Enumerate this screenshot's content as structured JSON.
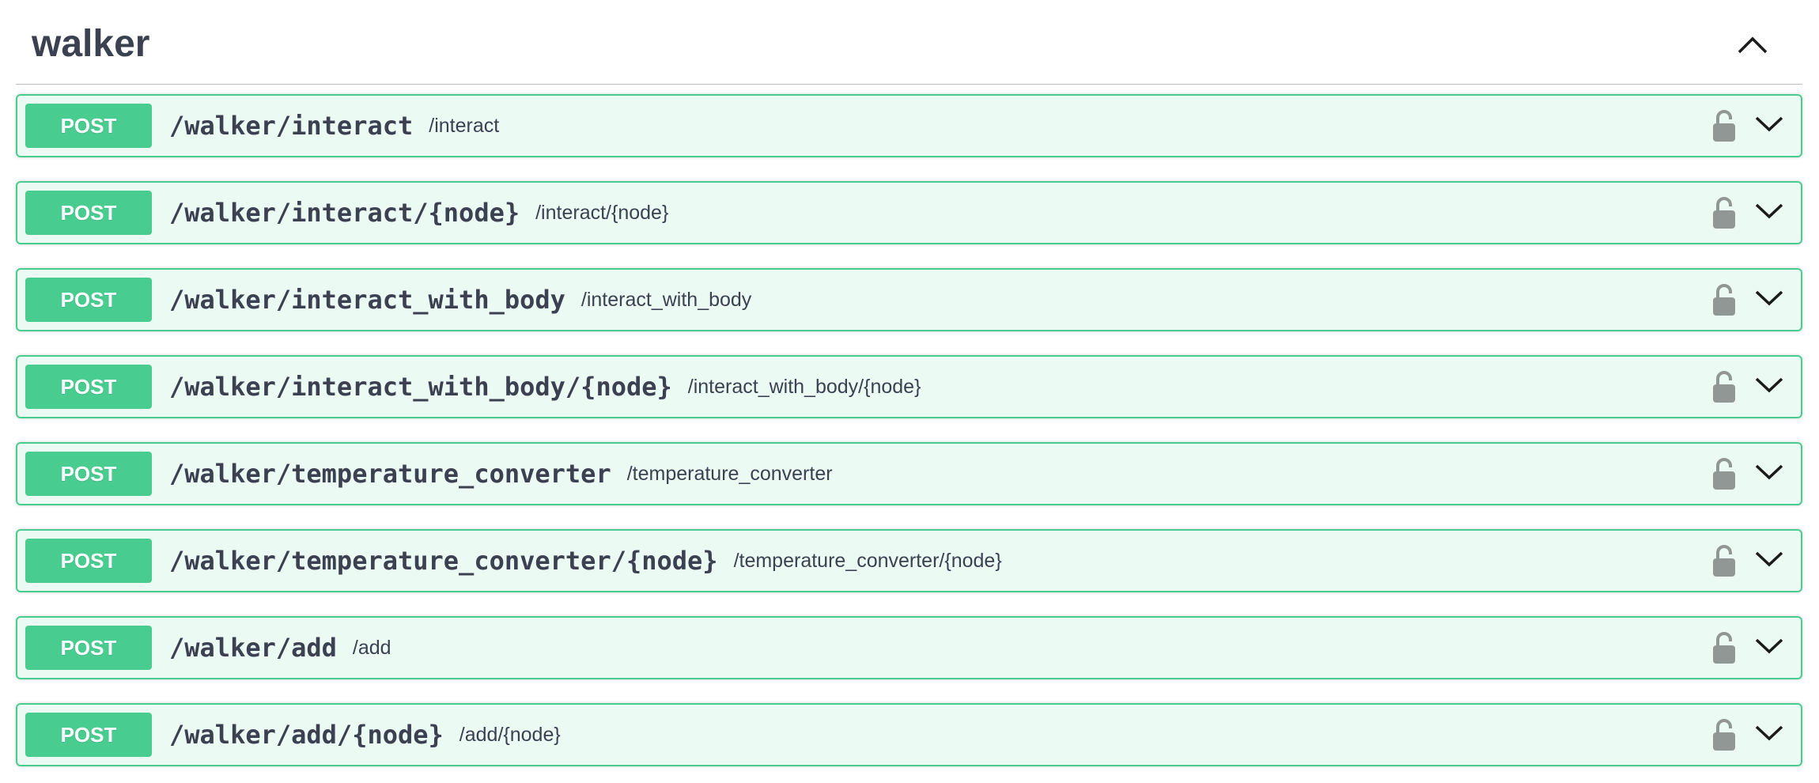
{
  "tag": {
    "title": "walker",
    "toggle_icon": "chevron-up-icon"
  },
  "colors": {
    "post_accent": "#49cc90",
    "text": "#3b4151",
    "lock_icon": "#919794"
  },
  "operations": [
    {
      "method": "POST",
      "path": "/walker/interact",
      "summary": "/interact"
    },
    {
      "method": "POST",
      "path": "/walker/interact/{node}",
      "summary": "/interact/{node}"
    },
    {
      "method": "POST",
      "path": "/walker/interact_with_body",
      "summary": "/interact_with_body"
    },
    {
      "method": "POST",
      "path": "/walker/interact_with_body/{node}",
      "summary": "/interact_with_body/{node}"
    },
    {
      "method": "POST",
      "path": "/walker/temperature_converter",
      "summary": "/temperature_converter"
    },
    {
      "method": "POST",
      "path": "/walker/temperature_converter/{node}",
      "summary": "/temperature_converter/{node}"
    },
    {
      "method": "POST",
      "path": "/walker/add",
      "summary": "/add"
    },
    {
      "method": "POST",
      "path": "/walker/add/{node}",
      "summary": "/add/{node}"
    }
  ],
  "icons": {
    "authorization": "lock-icon",
    "expand": "chevron-down-icon"
  }
}
